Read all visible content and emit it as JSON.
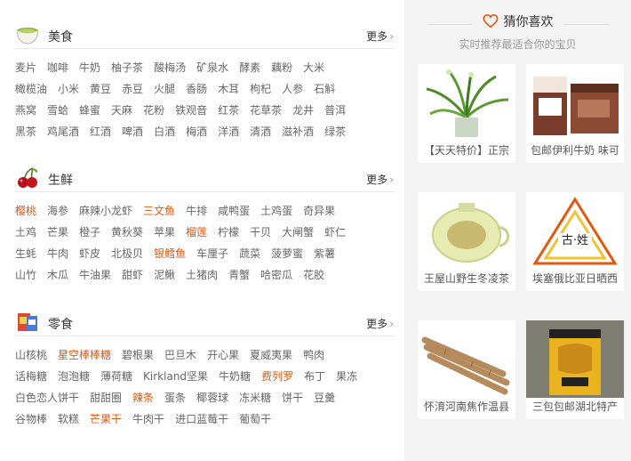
{
  "sections": [
    {
      "title": "美食",
      "more": "更多",
      "icon": "tea-bowl-icon",
      "rows": [
        [
          {
            "t": "麦片"
          },
          {
            "t": "咖啡"
          },
          {
            "t": "牛奶"
          },
          {
            "t": "柚子茶"
          },
          {
            "t": "酸梅汤"
          },
          {
            "t": "矿泉水"
          },
          {
            "t": "酵素"
          },
          {
            "t": "藕粉"
          },
          {
            "t": "大米"
          }
        ],
        [
          {
            "t": "橄榄油"
          },
          {
            "t": "小米"
          },
          {
            "t": "黄豆"
          },
          {
            "t": "赤豆"
          },
          {
            "t": "火腿"
          },
          {
            "t": "香肠"
          },
          {
            "t": "木耳"
          },
          {
            "t": "枸杞"
          },
          {
            "t": "人参"
          },
          {
            "t": "石斛"
          }
        ],
        [
          {
            "t": "燕窝"
          },
          {
            "t": "雪蛤"
          },
          {
            "t": "蜂蜜"
          },
          {
            "t": "天麻"
          },
          {
            "t": "花粉"
          },
          {
            "t": "铁观音"
          },
          {
            "t": "红茶"
          },
          {
            "t": "花草茶"
          },
          {
            "t": "龙井"
          },
          {
            "t": "普洱"
          }
        ],
        [
          {
            "t": "黑茶"
          },
          {
            "t": "鸡尾酒"
          },
          {
            "t": "红酒"
          },
          {
            "t": "啤酒"
          },
          {
            "t": "白酒"
          },
          {
            "t": "梅酒"
          },
          {
            "t": "洋酒"
          },
          {
            "t": "清酒"
          },
          {
            "t": "滋补酒"
          },
          {
            "t": "绿茶"
          }
        ]
      ]
    },
    {
      "title": "生鲜",
      "more": "更多",
      "icon": "cherry-icon",
      "rows": [
        [
          {
            "t": "樱桃",
            "hot": true
          },
          {
            "t": "海参"
          },
          {
            "t": "麻辣小龙虾"
          },
          {
            "t": "三文鱼",
            "hot": true
          },
          {
            "t": "牛排"
          },
          {
            "t": "咸鸭蛋"
          },
          {
            "t": "土鸡蛋"
          },
          {
            "t": "奇异果"
          }
        ],
        [
          {
            "t": "土鸡"
          },
          {
            "t": "芒果"
          },
          {
            "t": "橙子"
          },
          {
            "t": "黄秋葵"
          },
          {
            "t": "苹果"
          },
          {
            "t": "榴莲",
            "hot": true
          },
          {
            "t": "柠檬"
          },
          {
            "t": "干贝"
          },
          {
            "t": "大闸蟹"
          },
          {
            "t": "虾仁"
          }
        ],
        [
          {
            "t": "生蚝"
          },
          {
            "t": "牛肉"
          },
          {
            "t": "虾皮"
          },
          {
            "t": "北极贝"
          },
          {
            "t": "银鳕鱼",
            "hot": true
          },
          {
            "t": "车厘子"
          },
          {
            "t": "蔬菜"
          },
          {
            "t": "菠萝蜜"
          },
          {
            "t": "紫薯"
          }
        ],
        [
          {
            "t": "山竹"
          },
          {
            "t": "木瓜"
          },
          {
            "t": "牛油果"
          },
          {
            "t": "甜虾"
          },
          {
            "t": "泥鳅"
          },
          {
            "t": "土猪肉"
          },
          {
            "t": "青蟹"
          },
          {
            "t": "哈密瓜"
          },
          {
            "t": "花胶"
          }
        ]
      ]
    },
    {
      "title": "零食",
      "more": "更多",
      "icon": "snack-bag-icon",
      "rows": [
        [
          {
            "t": "山核桃"
          },
          {
            "t": "星空棒棒糖",
            "hot": true
          },
          {
            "t": "碧根果"
          },
          {
            "t": "巴旦木"
          },
          {
            "t": "开心果"
          },
          {
            "t": "夏威夷果"
          },
          {
            "t": "鸭肉"
          }
        ],
        [
          {
            "t": "话梅糖"
          },
          {
            "t": "泡泡糖"
          },
          {
            "t": "薄荷糖"
          },
          {
            "t": "Kirkland坚果"
          },
          {
            "t": "牛奶糖"
          },
          {
            "t": "费列罗",
            "hot": true
          },
          {
            "t": "布丁"
          },
          {
            "t": "果冻"
          }
        ],
        [
          {
            "t": "白色恋人饼干"
          },
          {
            "t": "甜甜圈"
          },
          {
            "t": "辣条",
            "hot": true
          },
          {
            "t": "蛋条"
          },
          {
            "t": "椰蓉球"
          },
          {
            "t": "冻米糖"
          },
          {
            "t": "饼干"
          },
          {
            "t": "豆羹"
          }
        ],
        [
          {
            "t": "谷物棒"
          },
          {
            "t": "软糕"
          },
          {
            "t": "芒果干",
            "hot": true
          },
          {
            "t": "牛肉干"
          },
          {
            "t": "进口蓝莓干"
          },
          {
            "t": "葡萄干"
          }
        ]
      ]
    }
  ],
  "recommend": {
    "title": "猜你喜欢",
    "subtitle": "实时推荐最适合你的宝贝",
    "items": [
      {
        "caption": "【天天特价】正宗",
        "img": "potted-orchid"
      },
      {
        "caption": "包邮伊利牛奶 味可",
        "img": "milk-box"
      },
      {
        "caption": "王屋山野生冬凌茶",
        "img": "tea-pot"
      },
      {
        "caption": "埃塞俄比亚日晒西",
        "img": "coffee-logo"
      },
      {
        "caption": "怀淯河南焦作温县",
        "img": "yam-sticks"
      },
      {
        "caption": "三包包邮湖北特产",
        "img": "snack-package"
      }
    ]
  },
  "colors": {
    "hot": "#e4570e",
    "accent": "#e4570e",
    "panel_bg": "#f3f3f3"
  }
}
